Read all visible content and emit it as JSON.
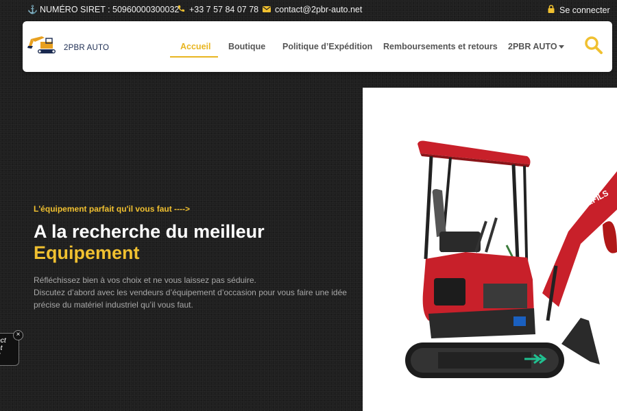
{
  "topbar": {
    "siret": "NUMÉRO SIRET : 50960000300032",
    "phone": "+33 7 57 84 07 78",
    "email": "contact@2pbr-auto.net",
    "login": "Se connecter"
  },
  "header": {
    "logo_text": "2PBR AUTO",
    "nav": [
      {
        "label": "Accueil",
        "active": true
      },
      {
        "label": "Boutique"
      },
      {
        "label": "Politique d’Expédition"
      },
      {
        "label": "Remboursements et retours"
      },
      {
        "label": "2PBR AUTO"
      }
    ]
  },
  "hero": {
    "kicker": "L'équipement parfait qu'il vous faut ---->",
    "title_line1": "A la recherche du meilleur",
    "title_line2": "Equipement",
    "desc_line1": "Réfléchissez bien à vos choix et ne vous laissez pas séduire.",
    "desc_line2": "Discutez d’abord avec les vendeurs d’équipement d’occasion pour vous faire une idée précise du matériel industriel qu’il vous faut.",
    "machine_brand": "JACK&FILS"
  },
  "chat_widget": {
    "text": "irect\nent\ne !"
  },
  "colors": {
    "accent": "#f0c030",
    "background": "#1f1f1f",
    "machine_red": "#c8202a"
  }
}
